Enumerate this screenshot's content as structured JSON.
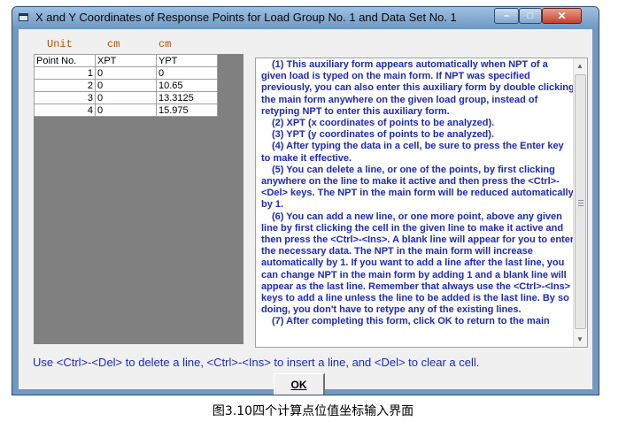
{
  "window": {
    "title": "X and Y Coordinates of Response Points for Load Group No. 1 and Data Set No. 1",
    "controls": {
      "minimize": "–",
      "maximize": "□",
      "close": "✕"
    }
  },
  "units": {
    "label": "Unit",
    "xpt": "cm",
    "ypt": "cm"
  },
  "grid": {
    "columns": [
      "Point No.",
      "XPT",
      "YPT"
    ],
    "rows": [
      {
        "no": "1",
        "xpt": "0",
        "ypt": "0"
      },
      {
        "no": "2",
        "xpt": "0",
        "ypt": "10.65"
      },
      {
        "no": "3",
        "xpt": "0",
        "ypt": "13.3125"
      },
      {
        "no": "4",
        "xpt": "0",
        "ypt": "15.975"
      }
    ]
  },
  "help": {
    "paragraphs": [
      "(1)  This auxiliary form appears automatically when NPT of a given load is typed on the main form.  If NPT was specified previously, you can also enter this auxiliary form by double clicking the main form anywhere on the given load group, instead of retyping NPT to enter this auxiliary form.",
      "(2)  XPT (x coordinates of points to be analyzed).",
      "(3)  YPT (y coordinates of points to be analyzed).",
      "(4)  After typing the data in a cell, be sure to press the Enter key to make it effective.",
      "(5)  You can delete a line, or one of the points, by first clicking anywhere on the line to make it active and then press the <Ctrl>-<Del> keys.  The NPT in the main form will be reduced automatically by 1.",
      "(6) You can add a new line, or one more point, above any given line by first clicking the cell in the given line to make it active and then press the <Ctrl>-<Ins>.  A blank line will appear for you to enter the necessary data.  The NPT in the main form will increase automatically by 1.  If you want to add a line after the last line, you can change NPT in the main form by adding 1 and a blank line will appear as the last line.  Remember that always use the <Ctrl>-<Ins> keys to add a line unless the line to be added is the last line.  By so doing, you don't have to retype any of the existing lines.",
      "(7) After completing this form, click OK to return to the main"
    ]
  },
  "hint": "Use <Ctrl>-<Del> to delete a line, <Ctrl>-<Ins> to insert a line, and <Del> to clear a cell.",
  "ok_label": "OK",
  "caption": "图3.10四个计算点位值坐标输入界面"
}
